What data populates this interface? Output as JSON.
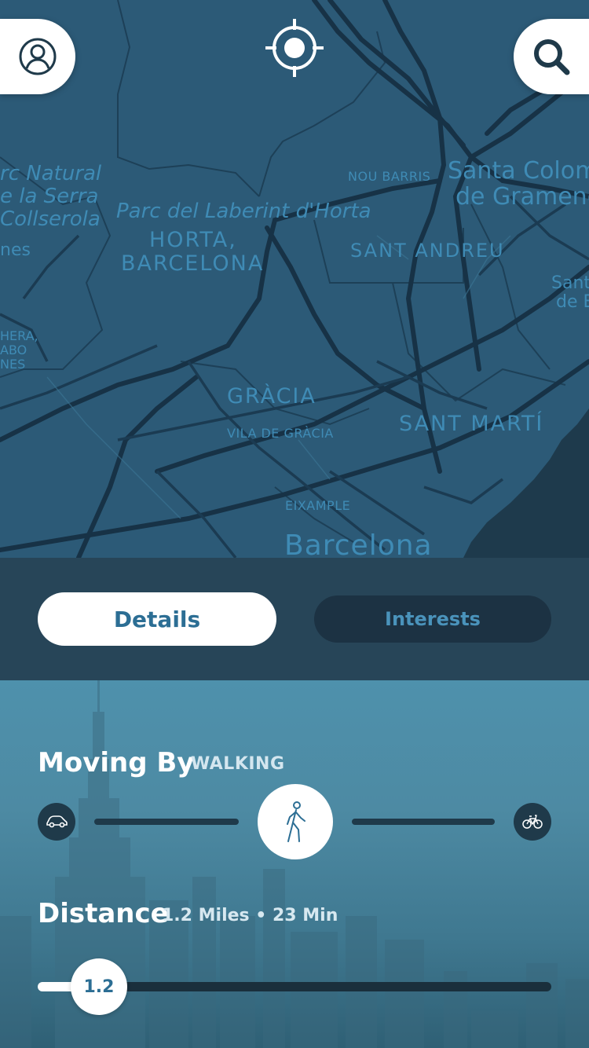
{
  "map": {
    "labels": {
      "parc_natural_1": "rc Natural",
      "parc_natural_2": "e la Serra",
      "parc_natural_3": "Collserola",
      "nes": "nes",
      "laberint": "Parc del Laberint d'Horta",
      "horta_1": "HORTA,",
      "horta_2": "BARCELONA",
      "nou_barris": "NOU BARRIS",
      "santa_coloma_1": "Santa Colom",
      "santa_coloma_2": "de Gramene",
      "sant_andreu": "SANT ANDREU",
      "sant_right_1": "Sant",
      "sant_right_2": "de E",
      "left_small_1": "HERA,",
      "left_small_2": "ABO",
      "left_small_3": "NES",
      "gracia": "GRÀCIA",
      "vila_gracia": "VILA DE GRÀCIA",
      "sant_marti": "SANT MARTÍ",
      "eixample": "EIXAMPLE",
      "barcelona": "Barcelona"
    },
    "colors": {
      "water": "#1e3a4c",
      "land": "#2c5a77",
      "road": "#173246",
      "label": "#3f8bb5"
    }
  },
  "top_bar": {
    "profile_icon": "user-circle-icon",
    "locate_icon": "crosshair-icon",
    "search_icon": "search-icon"
  },
  "tabs": {
    "details": "Details",
    "interests": "Interests",
    "active": "Details"
  },
  "moving_by": {
    "title": "Moving By",
    "mode": "WALKING",
    "options": [
      "car-icon",
      "walking-icon",
      "bicycle-icon"
    ],
    "selected": "walking-icon"
  },
  "distance": {
    "title": "Distance",
    "summary": "1.2 Miles • 23 Min",
    "slider_value": "1.2"
  },
  "colors": {
    "accent": "#2c6e94",
    "panel_top": "#4e91ac",
    "tab_bar": "#274558"
  }
}
